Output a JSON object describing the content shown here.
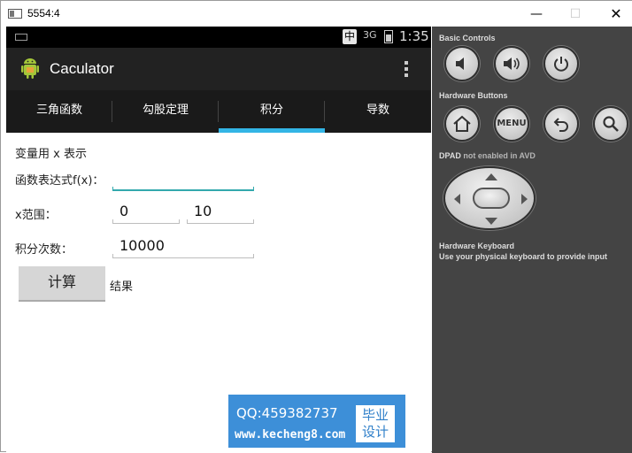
{
  "window": {
    "title": "5554:4",
    "minimize_glyph": "—",
    "maximize_glyph": "☐",
    "close_glyph": "✕"
  },
  "statusbar": {
    "ime_label": "中",
    "signal_label": "3G",
    "time": "1:35"
  },
  "actionbar": {
    "app_title": "Caculator",
    "logo_icon": "android-robot-icon",
    "overflow_icon": "overflow-menu-icon"
  },
  "tabs": [
    {
      "label": "三角函数",
      "active": false
    },
    {
      "label": "勾股定理",
      "active": false
    },
    {
      "label": "积分",
      "active": true
    },
    {
      "label": "导数",
      "active": false
    }
  ],
  "form": {
    "hint": "变量用 x 表示",
    "function_label": "函数表达式f(x)：",
    "function_value": "",
    "range_label": "x范围：",
    "range_from": "0",
    "range_to": "10",
    "count_label": "积分次数：",
    "count_value": "10000",
    "calc_button": "计算",
    "result_label": "结果"
  },
  "watermark": {
    "qq": "QQ:459382737",
    "site": "www.kecheng8.com",
    "badge_line1": "毕业",
    "badge_line2": "设计"
  },
  "panel": {
    "basic_controls": "Basic Controls",
    "hardware_buttons": "Hardware Buttons",
    "dpad_label": "DPAD",
    "dpad_note": "not enabled in AVD",
    "keyboard_title": "Hardware Keyboard",
    "keyboard_note": "Use your physical keyboard to provide input",
    "menu_label": "MENU"
  },
  "colors": {
    "tab_indicator": "#33b5e5",
    "focused_field": "#33a9ad",
    "panel_bg": "#444444",
    "watermark_bg": "#3d8fd8"
  }
}
